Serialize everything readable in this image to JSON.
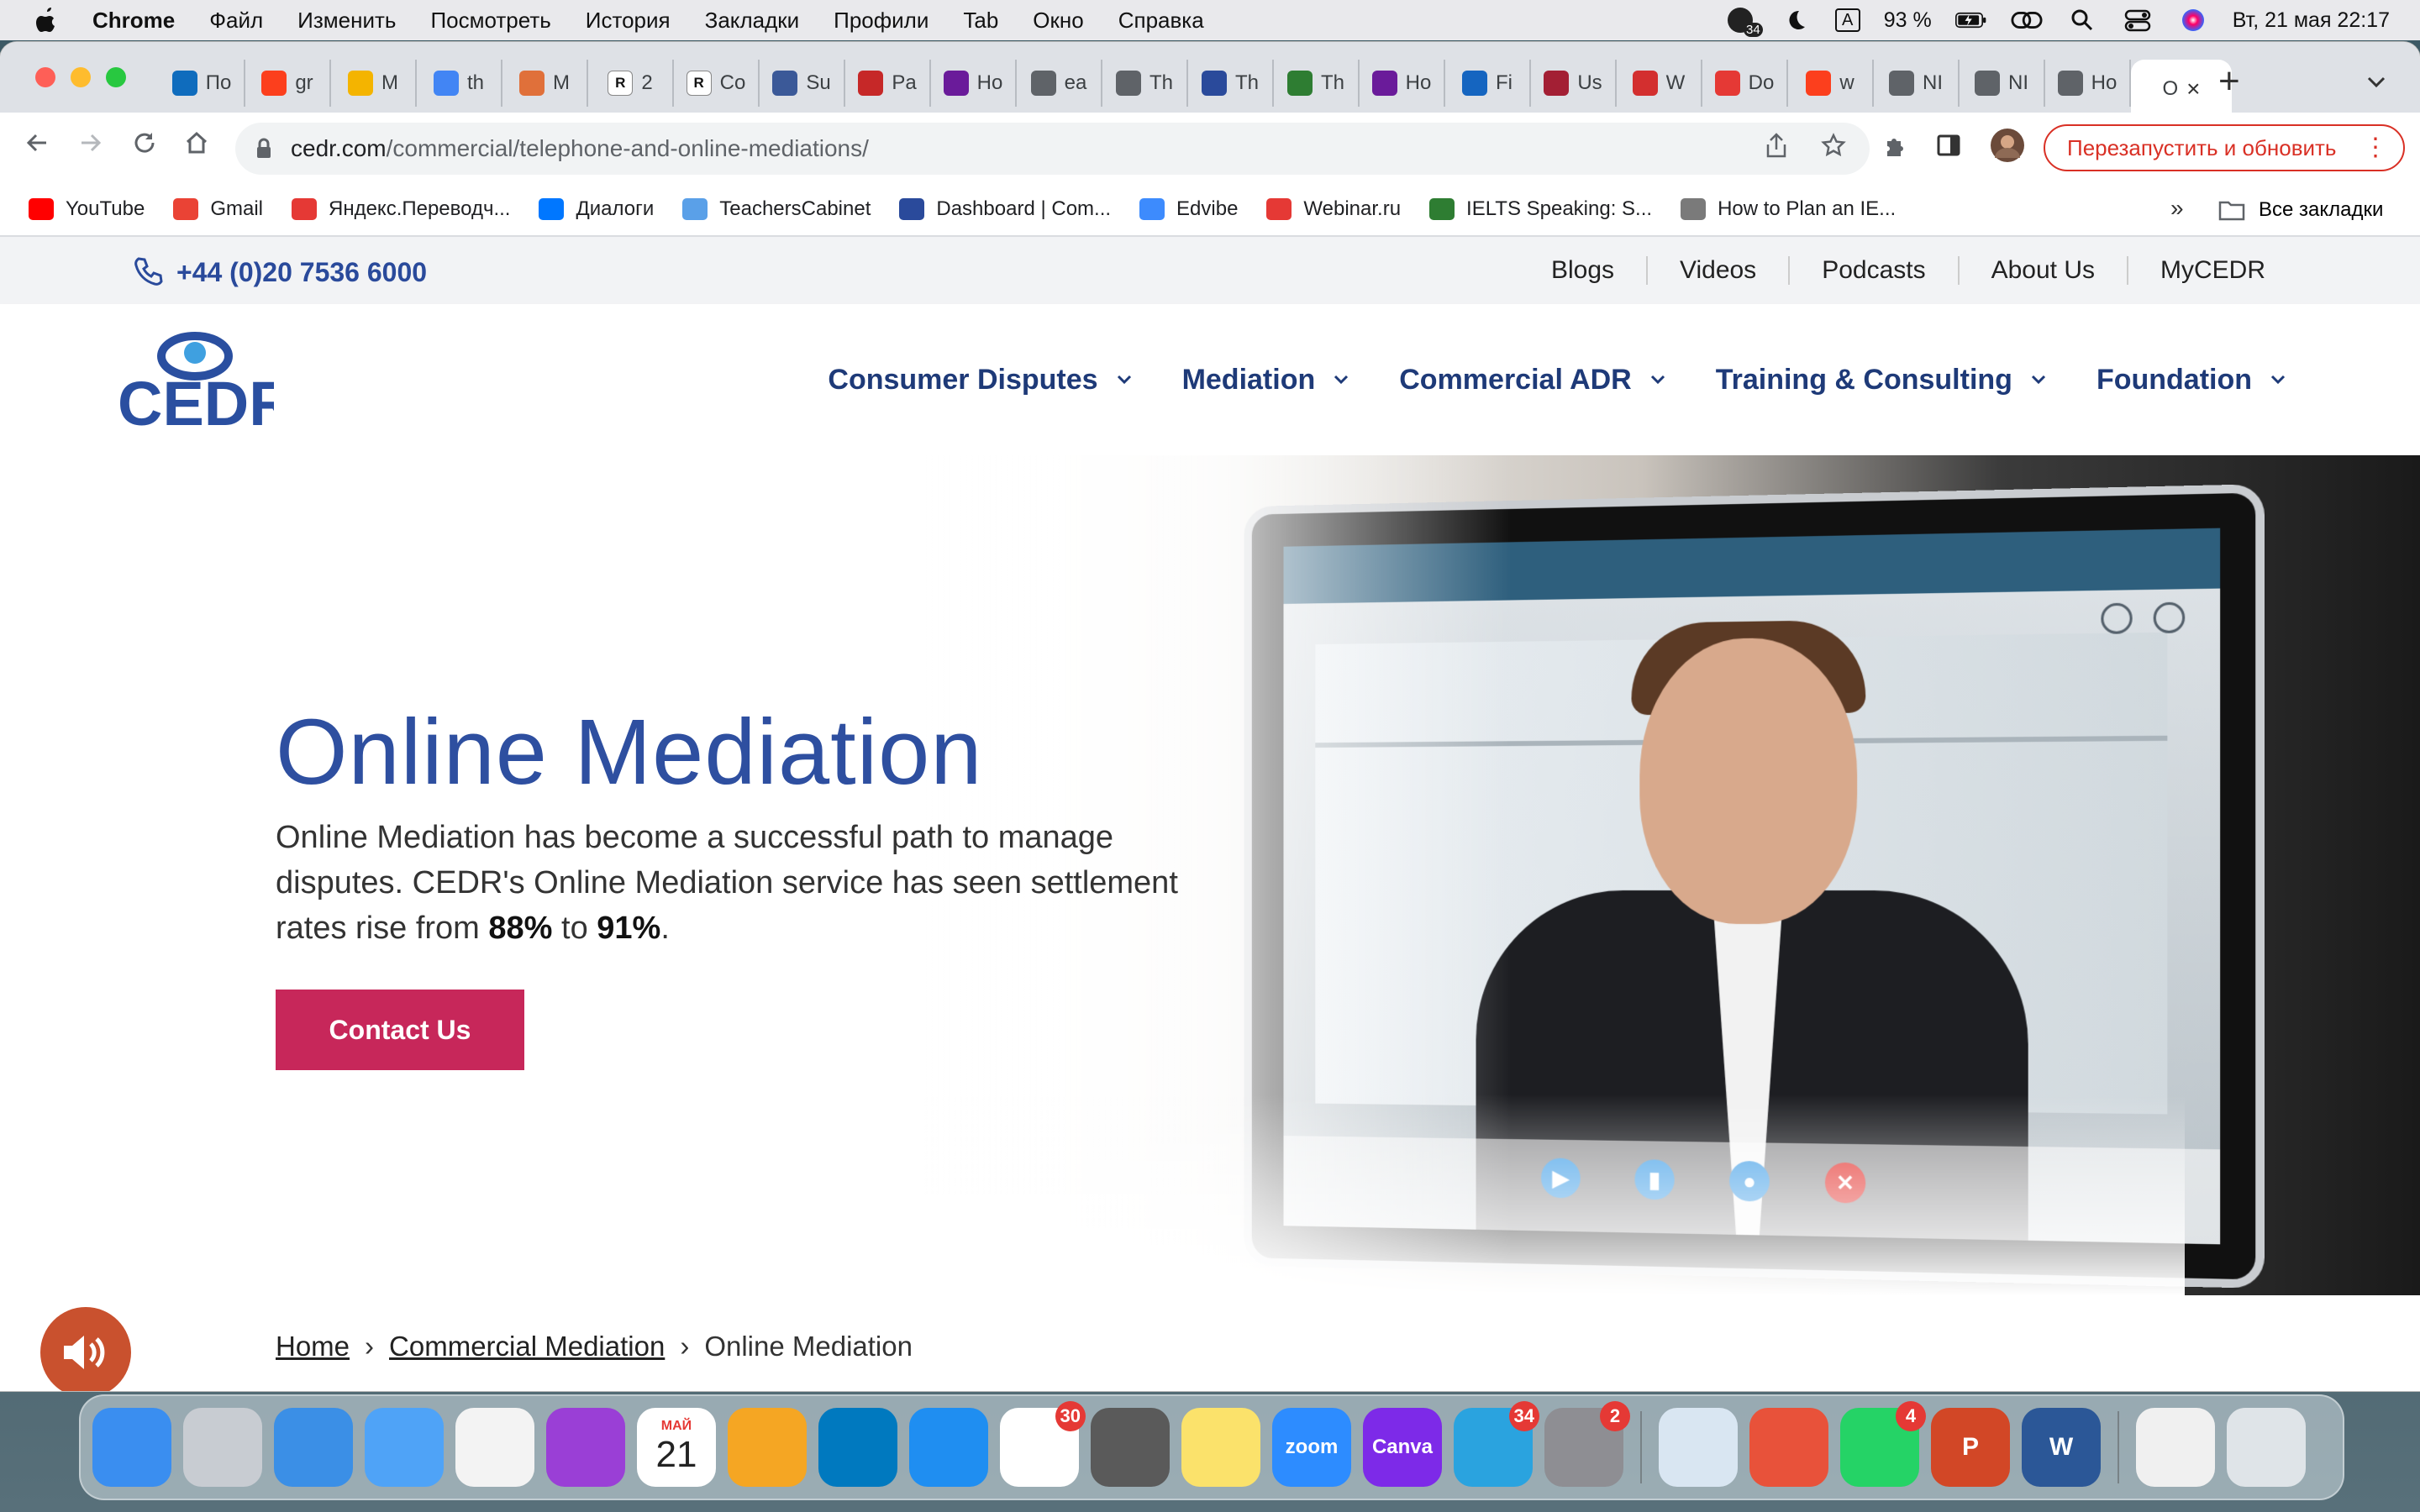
{
  "menubar": {
    "app": "Chrome",
    "items": [
      "Файл",
      "Изменить",
      "Посмотреть",
      "История",
      "Закладки",
      "Профили",
      "Tab",
      "Окно",
      "Справка"
    ],
    "battery": "93 %",
    "badge_count": "34",
    "input_source": "A",
    "datetime": "Вт, 21 мая  22:17"
  },
  "tabs": [
    {
      "label": "По",
      "icon": "outlook-icon",
      "color": "#0f6cbd"
    },
    {
      "label": "gr",
      "icon": "yandex-icon",
      "color": "#fc3f1d"
    },
    {
      "label": "M",
      "icon": "slides-icon",
      "color": "#f4b400"
    },
    {
      "label": "th",
      "icon": "google-icon",
      "color": "#4285f4"
    },
    {
      "label": "M",
      "icon": "globe-icon",
      "color": "#e0703a"
    },
    {
      "label": "2",
      "icon": "r6-icon",
      "color": "#ffffff"
    },
    {
      "label": "Co",
      "icon": "r6-icon",
      "color": "#ffffff"
    },
    {
      "label": "Su",
      "icon": "gear-icon",
      "color": "#3b5998"
    },
    {
      "label": "Pa",
      "icon": "vda-icon",
      "color": "#c62828"
    },
    {
      "label": "Ho",
      "icon": "circle-icon",
      "color": "#6a1b9a"
    },
    {
      "label": "ea",
      "icon": "globe-icon",
      "color": "#5f6368"
    },
    {
      "label": "Th",
      "icon": "globe-icon",
      "color": "#5f6368"
    },
    {
      "label": "Th",
      "icon": "triangle-icon",
      "color": "#2a4a9b"
    },
    {
      "label": "Th",
      "icon": "n-icon",
      "color": "#2e7d32"
    },
    {
      "label": "Ho",
      "icon": "circle-icon",
      "color": "#6a1b9a"
    },
    {
      "label": "Fi",
      "icon": "p-icon",
      "color": "#1565c0"
    },
    {
      "label": "Us",
      "icon": "shield-icon",
      "color": "#a31f34"
    },
    {
      "label": "W",
      "icon": "circle-icon",
      "color": "#d32f2f"
    },
    {
      "label": "Do",
      "icon": "translate-icon",
      "color": "#e53935"
    },
    {
      "label": "w",
      "icon": "yandex-icon",
      "color": "#fc3f1d"
    },
    {
      "label": "NI",
      "icon": "globe-icon",
      "color": "#5f6368"
    },
    {
      "label": "NI",
      "icon": "globe-icon",
      "color": "#5f6368"
    },
    {
      "label": "Ho",
      "icon": "globe-icon",
      "color": "#5f6368"
    },
    {
      "label": "O",
      "icon": "active",
      "color": "#5f6368"
    }
  ],
  "address": {
    "host": "cedr.com",
    "path": "/commercial/telephone-and-online-mediations/"
  },
  "relaunch_label": "Перезапустить и обновить",
  "bookmarks": [
    {
      "label": "YouTube",
      "icon": "youtube-icon",
      "color": "#ff0000"
    },
    {
      "label": "Gmail",
      "icon": "gmail-icon",
      "color": "#ea4335"
    },
    {
      "label": "Яндекс.Переводч...",
      "icon": "translate-icon",
      "color": "#e53935"
    },
    {
      "label": "Диалоги",
      "icon": "vk-icon",
      "color": "#0077ff"
    },
    {
      "label": "TeachersCabinet",
      "icon": "play-icon",
      "color": "#5aa0e8"
    },
    {
      "label": "Dashboard | Com...",
      "icon": "dashboard-icon",
      "color": "#2a4a9b"
    },
    {
      "label": "Edvibe",
      "icon": "edvibe-icon",
      "color": "#3d8bfd"
    },
    {
      "label": "Webinar.ru",
      "icon": "webinar-icon",
      "color": "#e53935"
    },
    {
      "label": "IELTS Speaking: S...",
      "icon": "check-icon",
      "color": "#2e7d32"
    },
    {
      "label": "How to Plan an IE...",
      "icon": "ielts-icon",
      "color": "#7a7a7a"
    }
  ],
  "all_bookmarks": "Все закладки",
  "site": {
    "phone": "+44 (0)20 7536 6000",
    "top_links": [
      "Blogs",
      "Videos",
      "Podcasts",
      "About Us",
      "MyCEDR"
    ],
    "logo": "CEDR",
    "nav": [
      "Consumer Disputes",
      "Mediation",
      "Commercial ADR",
      "Training & Consulting",
      "Foundation"
    ],
    "hero": {
      "title": "Online Mediation",
      "text_1": "Online Mediation has become a successful path to manage disputes. CEDR's Online Mediation service has seen settlement rates rise from ",
      "rate_from": "88%",
      "text_2": " to ",
      "rate_to": "91%",
      "text_3": ".",
      "cta": "Contact Us"
    },
    "breadcrumb": {
      "home": "Home",
      "sep": "›",
      "parent": "Commercial Mediation",
      "current": "Online Mediation"
    }
  },
  "dock": [
    {
      "name": "finder-icon",
      "color": "#3a8ef0",
      "label": ""
    },
    {
      "name": "launchpad-icon",
      "color": "#c8ccd2",
      "label": ""
    },
    {
      "name": "safari-icon",
      "color": "#3b8fe6",
      "label": ""
    },
    {
      "name": "mail-icon",
      "color": "#4fa3f7",
      "label": ""
    },
    {
      "name": "photos-icon",
      "color": "#f3f3f3",
      "label": ""
    },
    {
      "name": "podcasts-icon",
      "color": "#9a3fd6",
      "label": ""
    },
    {
      "name": "calendar-icon",
      "color": "#ffffff",
      "label": "21",
      "sublabel": "МАЙ"
    },
    {
      "name": "pages-icon",
      "color": "#f5a623",
      "label": ""
    },
    {
      "name": "trello-icon",
      "color": "#0079bf",
      "label": ""
    },
    {
      "name": "appstore-icon",
      "color": "#1f8ef1",
      "label": ""
    },
    {
      "name": "chrome-icon",
      "color": "#ffffff",
      "label": "",
      "badge": "30"
    },
    {
      "name": "calculator-icon",
      "color": "#5a5a5a",
      "label": ""
    },
    {
      "name": "notes-icon",
      "color": "#fbe26b",
      "label": ""
    },
    {
      "name": "zoom-icon",
      "color": "#2d8cff",
      "label": "zoom"
    },
    {
      "name": "canva-icon",
      "color": "#7d2ae8",
      "label": "Canva"
    },
    {
      "name": "telegram-icon",
      "color": "#2aa3df",
      "label": "",
      "badge": "34"
    },
    {
      "name": "settings-icon",
      "color": "#8e8e93",
      "label": "",
      "badge": "2"
    },
    {
      "name": "preview-icon",
      "color": "#d9e6f2",
      "label": ""
    },
    {
      "name": "xmind-icon",
      "color": "#e8523a",
      "label": ""
    },
    {
      "name": "whatsapp-icon",
      "color": "#25d366",
      "label": "",
      "badge": "4"
    },
    {
      "name": "powerpoint-icon",
      "color": "#d24726",
      "label": "P"
    },
    {
      "name": "word-icon",
      "color": "#2b5797",
      "label": "W"
    },
    {
      "name": "document-thumb-icon",
      "color": "#f0f0f0",
      "label": ""
    },
    {
      "name": "trash-icon",
      "color": "#dfe4e8",
      "label": ""
    }
  ]
}
